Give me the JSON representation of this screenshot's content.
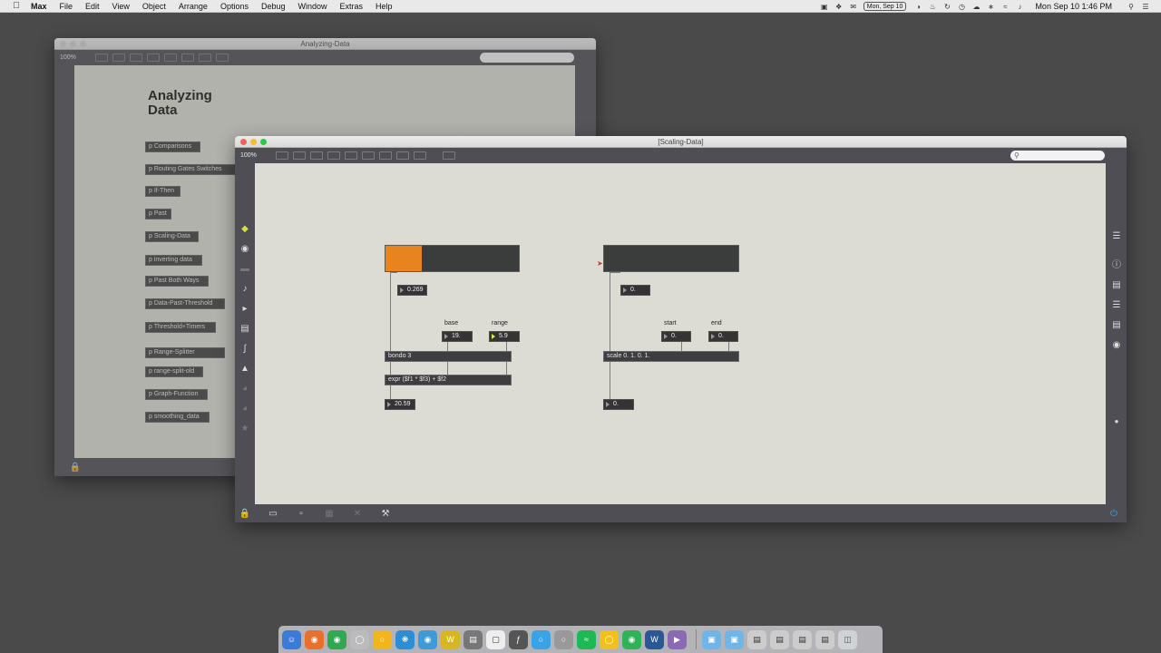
{
  "menubar": {
    "app_name": "Max",
    "items": [
      "File",
      "Edit",
      "View",
      "Object",
      "Arrange",
      "Options",
      "Debug",
      "Window",
      "Extras",
      "Help"
    ],
    "date_badge": "Mon, Sep 10",
    "clock": "Mon Sep 10  1:46 PM"
  },
  "back_window": {
    "title": "Analyzing-Data",
    "zoom": "100%",
    "heading_line1": "Analyzing",
    "heading_line2": "Data",
    "subpatchers": [
      "p Comparisons",
      "p Routing Gates Switches",
      "p If-Then",
      "p Past",
      "p Scaling-Data",
      "p inverting data",
      "p Past Both Ways",
      "p Data-Past-Threshold",
      "p Threshold+Timers",
      "p Range-Splitter",
      "p range-split-old",
      "p Graph-Function",
      "p smoothing_data"
    ]
  },
  "front_window": {
    "title": "[Scaling-Data]",
    "zoom": "100%",
    "patch": {
      "left_slider_level": 0.269,
      "left_slider_number": "0.269",
      "base_label": "base",
      "range_label": "range",
      "base_value": "19.",
      "range_value": "5.9",
      "obj_bondo": "bondo 3",
      "obj_expr": "expr ($f1 * $f3) + $f2",
      "output_left": "20.59",
      "right_slider_level": 0,
      "right_slider_number": "0.",
      "start_label": "start",
      "end_label": "end",
      "start_value": "0.",
      "end_value": "0.",
      "obj_scale": "scale 0. 1. 0. 1.",
      "output_right": "0."
    }
  },
  "colors": {
    "accent": "#e8841f",
    "canvas": "#dcdcd4",
    "chrome": "#4e4e54"
  }
}
